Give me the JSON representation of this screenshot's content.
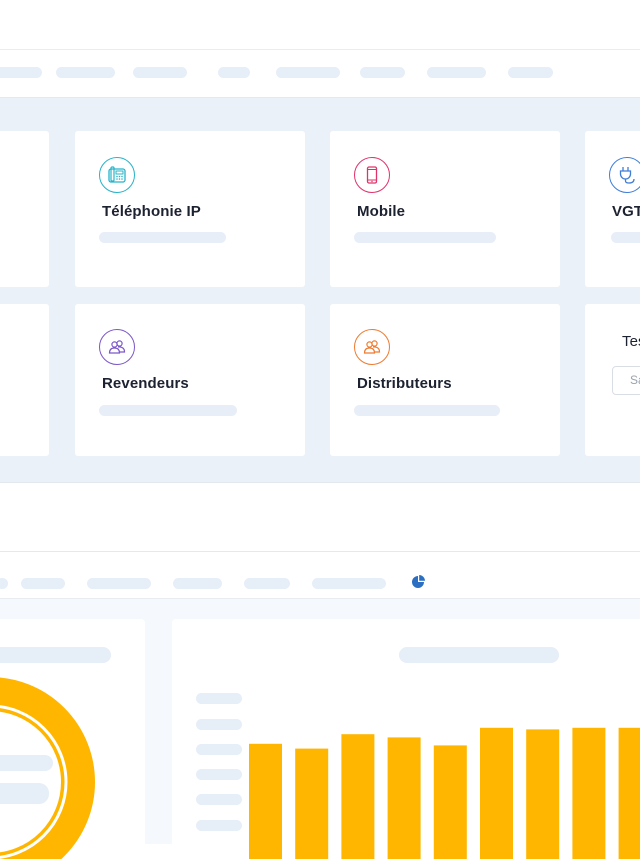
{
  "cards_row1": [
    {
      "title": "Téléphonie IP",
      "icon": "ip-phone-icon",
      "color": "#26b3c9"
    },
    {
      "title": "Mobile",
      "icon": "mobile-phone-icon",
      "color": "#e0336a"
    },
    {
      "title": "VGT",
      "icon": "plug-icon",
      "color": "#3f7ed8"
    }
  ],
  "cards_row2": [
    {
      "title": "Revendeurs",
      "icon": "users-icon",
      "color": "#7b57c8"
    },
    {
      "title": "Distributeurs",
      "icon": "users-icon",
      "color": "#ef7b2f"
    }
  ],
  "test_card": {
    "title": "Tes",
    "input_placeholder": "Sa"
  },
  "colors": {
    "bar": "#ffb600",
    "donut": "#ffb600",
    "accent_pie": "#2a6fc2"
  },
  "bars": [
    0.72,
    0.69,
    0.78,
    0.76,
    0.71,
    0.82,
    0.81,
    0.82,
    0.82
  ]
}
